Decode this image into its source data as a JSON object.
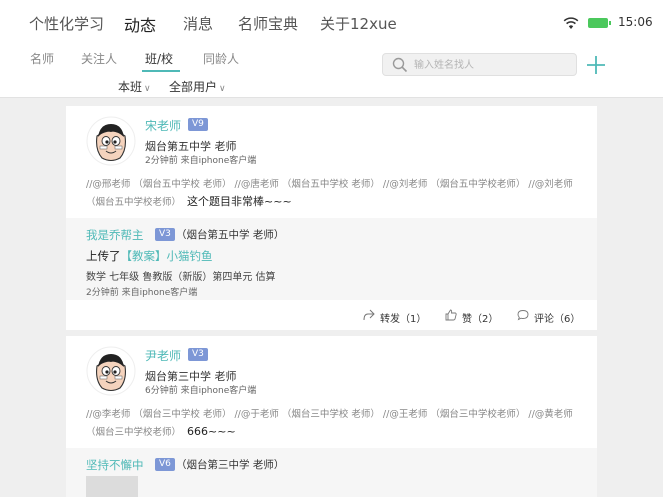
{
  "nav": {
    "items": [
      {
        "label": "个性化学习"
      },
      {
        "label": "动态",
        "active": true
      },
      {
        "label": "消息"
      },
      {
        "label": "名师宝典"
      },
      {
        "label": "关于12xue"
      }
    ]
  },
  "status": {
    "time": "15:06",
    "battery_color": "#4bc85c"
  },
  "subtabs": [
    {
      "label": "名师"
    },
    {
      "label": "关注人"
    },
    {
      "label": "班/校",
      "active": true
    },
    {
      "label": "同龄人"
    }
  ],
  "filters": {
    "class": "本班",
    "users": "全部用户"
  },
  "search": {
    "placeholder": "输入姓名找人"
  },
  "accent": "#4fb9b7",
  "posts": [
    {
      "name": "宋老师",
      "badge": "V9",
      "school": "烟台第五中学  老师",
      "meta": "2分钟前   来自iphone客户端",
      "mentions": "//@邢老师 （烟台五中学校 老师） //@唐老师 （烟台五中学校 老师） //@刘老师 （烟台五中学校老师） //@刘老师 （烟台五中学校老师）",
      "message": "这个题目非常棒~~~",
      "repost": {
        "name": "我是乔帮主",
        "badge": "V3",
        "school": "（烟台第五中学  老师）",
        "action": "上传了",
        "link": "【教案】小猫钓鱼",
        "desc": "数学  七年级  鲁教版（新版）第四单元  估算",
        "meta": "2分钟前   来自iphone客户端"
      },
      "actions": {
        "forward": "转发（1）",
        "like": "赞（2）",
        "comment": "评论（6）"
      }
    },
    {
      "name": "尹老师",
      "badge": "V3",
      "school": "烟台第三中学  老师",
      "meta": "6分钟前   来自iphone客户端",
      "mentions": "//@李老师 （烟台三中学校 老师） //@于老师 （烟台三中学校 老师） //@王老师 （烟台三中学校老师） //@黄老师 （烟台三中学校老师）",
      "message": "666~~~",
      "repost": {
        "name": "坚持不懈中",
        "badge": "V6",
        "school": "（烟台第三中学  老师）"
      }
    }
  ]
}
